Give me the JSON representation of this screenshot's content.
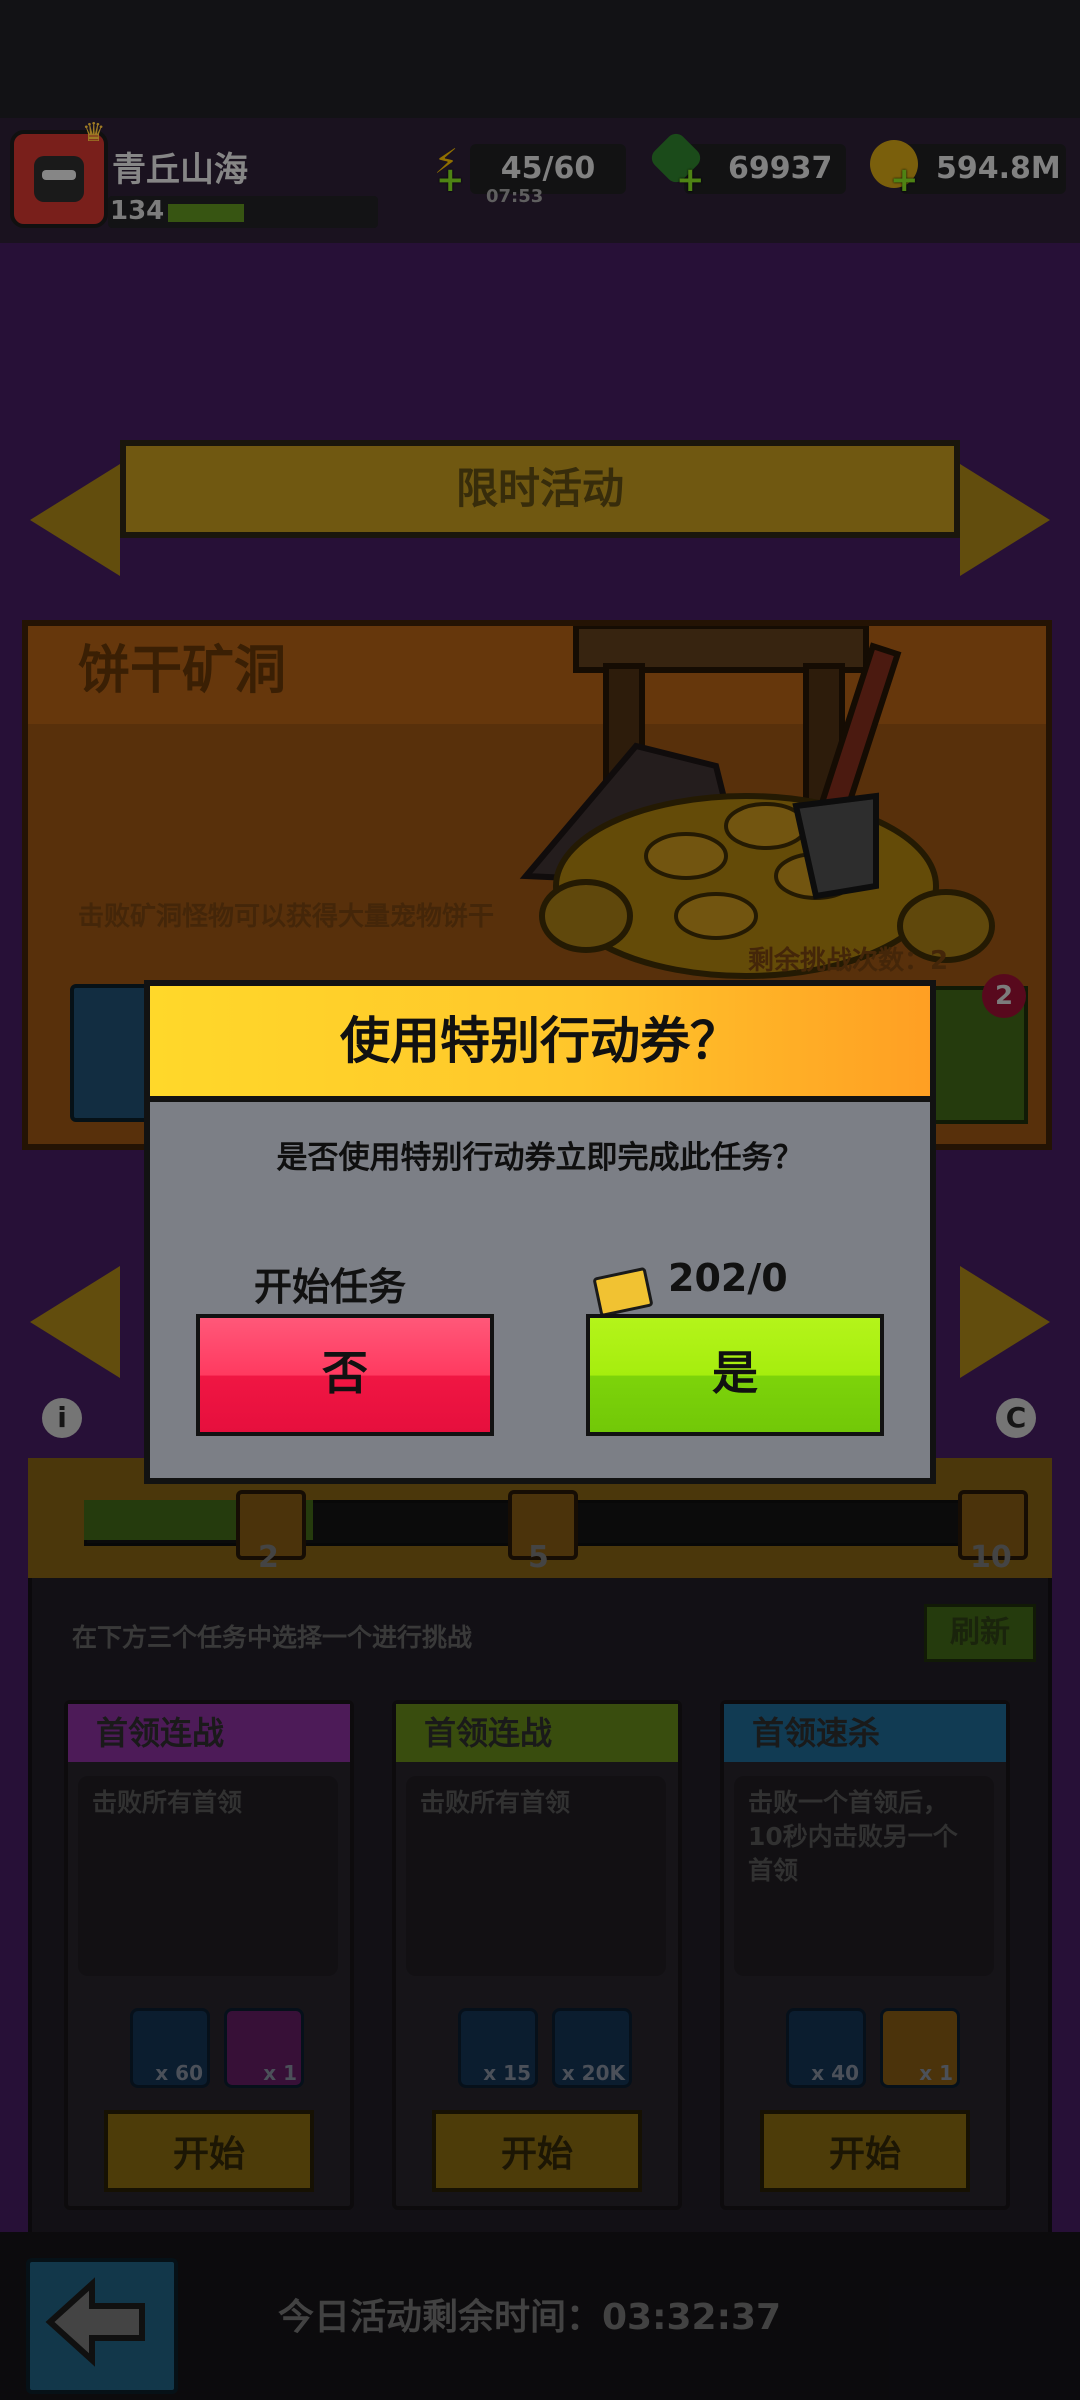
{
  "player": {
    "name": "青丘山海",
    "level": "134"
  },
  "resources": {
    "energy": "45/60",
    "energy_timer": "07:53",
    "gems": "69937",
    "coins": "594.8M"
  },
  "background": {
    "banner_title": "限时活动",
    "event_title": "饼干矿洞",
    "event_desc": "击败矿洞怪物可以获得大量宠物饼干",
    "remaining_challenges": "剩余挑战次数：2",
    "badge_count": "2",
    "progress_fraction": 0.26,
    "milestones": [
      "2",
      "5",
      "10"
    ],
    "choose_hint": "在下方三个任务中选择一个进行挑战",
    "refresh_label": "刷新",
    "tasks": [
      {
        "title": "首领连战",
        "desc": "击败所有首领",
        "rewards": [
          "x 60",
          "x 1"
        ],
        "start": "开始",
        "color": "#7d2c8f"
      },
      {
        "title": "首领连战",
        "desc": "击败所有首领",
        "rewards": [
          "x 15",
          "x 20K"
        ],
        "start": "开始",
        "color": "#5d7c17"
      },
      {
        "title": "首领速杀",
        "desc": "击败一个首领后，10秒内击败另一个首领",
        "rewards": [
          "x 40",
          "x 1"
        ],
        "start": "开始",
        "color": "#1c5f86"
      }
    ],
    "timer_label": "今日活动剩余时间：03:32:37"
  },
  "dialog": {
    "title": "使用特别行动券？",
    "message": "是否使用特别行动券立即完成此任务？",
    "left_label": "开始任务",
    "right_label": "202/0",
    "no_label": "否",
    "yes_label": "是"
  }
}
